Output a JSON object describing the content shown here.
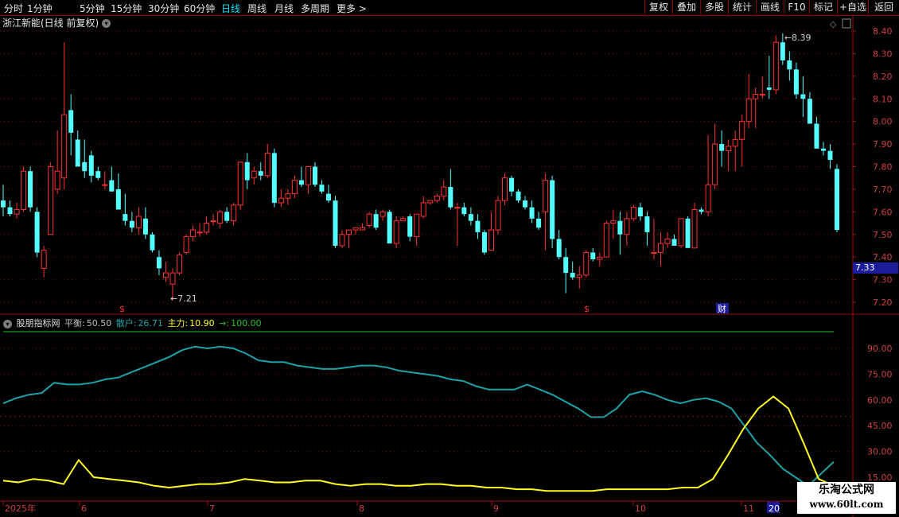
{
  "toolbar": {
    "periods": [
      "分时",
      "1分钟",
      "5分钟",
      "15分钟",
      "30分钟",
      "60分钟",
      "日线",
      "周线",
      "月线",
      "多周期",
      "更多 >"
    ],
    "active_period": "日线",
    "right_buttons": [
      "复权",
      "叠加",
      "多股",
      "统计",
      "画线",
      "F10",
      "标记",
      "+自选",
      "返回"
    ]
  },
  "title": {
    "name": "浙江新能(日线 前复权)"
  },
  "price_axis": [
    "8.40",
    "8.30",
    "8.20",
    "8.10",
    "8.00",
    "7.90",
    "7.80",
    "7.70",
    "7.60",
    "7.50",
    "7.40",
    "7.30",
    "7.20"
  ],
  "current_price": "7.33",
  "annotations": {
    "high": "8.39",
    "low": "7.21",
    "marker_s": "$",
    "marker_cai": "财"
  },
  "indicator": {
    "name": "股朋指标网",
    "balance_label": "平衡:",
    "balance_value": "50.50",
    "retail_label": "散户:",
    "retail_value": "26.71",
    "main_label": "主力:",
    "main_value": "10.90",
    "arrow_label": "→:",
    "arrow_value": "100.00",
    "axis": [
      "90.00",
      "75.00",
      "60.00",
      "45.00",
      "30.00",
      "15.00"
    ]
  },
  "date_axis": [
    "2025年",
    "6",
    "7",
    "8",
    "9",
    "10",
    "11",
    "20"
  ],
  "watermark": {
    "line1": "乐淘公式网",
    "line2": "www.60lt.com"
  },
  "colors": {
    "up": "#ff3232",
    "down": "#54ffff",
    "retail": "#1aa3a8",
    "main": "#ffff20",
    "balance": "#25c225"
  },
  "chart_data": {
    "type": "candlestick",
    "series": [
      {
        "name": "K线",
        "ohlc": [
          [
            7.65,
            7.72,
            7.58,
            7.62
          ],
          [
            7.62,
            7.65,
            7.58,
            7.59
          ],
          [
            7.59,
            7.64,
            7.57,
            7.61
          ],
          [
            7.61,
            7.8,
            7.6,
            7.78
          ],
          [
            7.78,
            7.8,
            7.6,
            7.62
          ],
          [
            7.6,
            7.62,
            7.4,
            7.42
          ],
          [
            7.35,
            7.45,
            7.31,
            7.43
          ],
          [
            7.5,
            7.82,
            7.5,
            7.8
          ],
          [
            7.7,
            7.96,
            7.68,
            7.78
          ],
          [
            7.75,
            8.35,
            7.7,
            8.03
          ],
          [
            8.05,
            8.12,
            7.85,
            7.95
          ],
          [
            7.92,
            7.96,
            7.8,
            7.8
          ],
          [
            7.82,
            7.92,
            7.75,
            7.78
          ],
          [
            7.85,
            7.87,
            7.73,
            7.76
          ],
          [
            7.78,
            7.8,
            7.74,
            7.75
          ],
          [
            7.72,
            7.78,
            7.7,
            7.72
          ],
          [
            7.74,
            7.8,
            7.69,
            7.69
          ],
          [
            7.7,
            7.77,
            7.61,
            7.61
          ],
          [
            7.59,
            7.68,
            7.54,
            7.56
          ],
          [
            7.56,
            7.6,
            7.51,
            7.53
          ],
          [
            7.53,
            7.62,
            7.5,
            7.58
          ],
          [
            7.57,
            7.62,
            7.48,
            7.5
          ],
          [
            7.5,
            7.51,
            7.42,
            7.43
          ],
          [
            7.4,
            7.43,
            7.32,
            7.35
          ],
          [
            7.31,
            7.38,
            7.29,
            7.33
          ],
          [
            7.28,
            7.35,
            7.21,
            7.33
          ],
          [
            7.33,
            7.42,
            7.32,
            7.41
          ],
          [
            7.42,
            7.5,
            7.41,
            7.49
          ],
          [
            7.49,
            7.54,
            7.47,
            7.52
          ],
          [
            7.51,
            7.55,
            7.49,
            7.51
          ],
          [
            7.51,
            7.58,
            7.5,
            7.55
          ],
          [
            7.56,
            7.59,
            7.54,
            7.56
          ],
          [
            7.55,
            7.61,
            7.53,
            7.6
          ],
          [
            7.6,
            7.62,
            7.55,
            7.56
          ],
          [
            7.56,
            7.64,
            7.54,
            7.63
          ],
          [
            7.63,
            7.82,
            7.61,
            7.82
          ],
          [
            7.82,
            7.86,
            7.7,
            7.74
          ],
          [
            7.75,
            7.8,
            7.72,
            7.78
          ],
          [
            7.78,
            7.82,
            7.74,
            7.76
          ],
          [
            7.76,
            7.9,
            7.75,
            7.86
          ],
          [
            7.86,
            7.88,
            7.62,
            7.64
          ],
          [
            7.64,
            7.7,
            7.62,
            7.66
          ],
          [
            7.66,
            7.7,
            7.63,
            7.68
          ],
          [
            7.68,
            7.76,
            7.66,
            7.74
          ],
          [
            7.74,
            7.8,
            7.71,
            7.72
          ],
          [
            7.72,
            7.8,
            7.68,
            7.8
          ],
          [
            7.8,
            7.82,
            7.71,
            7.72
          ],
          [
            7.72,
            7.74,
            7.68,
            7.69
          ],
          [
            7.68,
            7.72,
            7.64,
            7.65
          ],
          [
            7.65,
            7.67,
            7.44,
            7.45
          ],
          [
            7.45,
            7.52,
            7.44,
            7.5
          ],
          [
            7.5,
            7.52,
            7.44,
            7.52
          ],
          [
            7.52,
            7.53,
            7.5,
            7.53
          ],
          [
            7.52,
            7.55,
            7.52,
            7.53
          ],
          [
            7.54,
            7.6,
            7.53,
            7.59
          ],
          [
            7.59,
            7.61,
            7.52,
            7.53
          ],
          [
            7.58,
            7.61,
            7.56,
            7.6
          ],
          [
            7.6,
            7.61,
            7.46,
            7.46
          ],
          [
            7.46,
            7.58,
            7.44,
            7.56
          ],
          [
            7.56,
            7.58,
            7.57,
            7.57
          ],
          [
            7.58,
            7.59,
            7.47,
            7.49
          ],
          [
            7.49,
            7.59,
            7.45,
            7.59
          ],
          [
            7.58,
            7.67,
            7.57,
            7.64
          ],
          [
            7.64,
            7.65,
            7.63,
            7.65
          ],
          [
            7.65,
            7.68,
            7.64,
            7.67
          ],
          [
            7.67,
            7.74,
            7.65,
            7.71
          ],
          [
            7.71,
            7.79,
            7.61,
            7.62
          ],
          [
            7.62,
            7.64,
            7.45,
            7.62
          ],
          [
            7.62,
            7.64,
            7.58,
            7.59
          ],
          [
            7.59,
            7.62,
            7.54,
            7.56
          ],
          [
            7.56,
            7.59,
            7.48,
            7.51
          ],
          [
            7.51,
            7.52,
            7.41,
            7.42
          ],
          [
            7.43,
            7.6,
            7.43,
            7.52
          ],
          [
            7.52,
            7.67,
            7.5,
            7.65
          ],
          [
            7.65,
            7.77,
            7.63,
            7.75
          ],
          [
            7.75,
            7.76,
            7.67,
            7.69
          ],
          [
            7.69,
            7.7,
            7.64,
            7.65
          ],
          [
            7.65,
            7.67,
            7.61,
            7.62
          ],
          [
            7.62,
            7.65,
            7.55,
            7.57
          ],
          [
            7.57,
            7.6,
            7.52,
            7.53
          ],
          [
            7.6,
            7.77,
            7.43,
            7.74
          ],
          [
            7.74,
            7.76,
            7.44,
            7.48
          ],
          [
            7.48,
            7.52,
            7.39,
            7.4
          ],
          [
            7.4,
            7.44,
            7.24,
            7.33
          ],
          [
            7.33,
            7.38,
            7.3,
            7.31
          ],
          [
            7.31,
            7.36,
            7.26,
            7.32
          ],
          [
            7.32,
            7.43,
            7.31,
            7.42
          ],
          [
            7.42,
            7.44,
            7.38,
            7.39
          ],
          [
            7.39,
            7.42,
            7.36,
            7.4
          ],
          [
            7.4,
            7.56,
            7.4,
            7.55
          ],
          [
            7.55,
            7.61,
            7.48,
            7.56
          ],
          [
            7.56,
            7.6,
            7.41,
            7.5
          ],
          [
            7.5,
            7.6,
            7.45,
            7.57
          ],
          [
            7.57,
            7.63,
            7.56,
            7.62
          ],
          [
            7.62,
            7.64,
            7.56,
            7.58
          ],
          [
            7.58,
            7.6,
            7.45,
            7.51
          ],
          [
            7.42,
            7.57,
            7.39,
            7.42
          ],
          [
            7.42,
            7.51,
            7.36,
            7.46
          ],
          [
            7.46,
            7.51,
            7.44,
            7.48
          ],
          [
            7.48,
            7.5,
            7.45,
            7.45
          ],
          [
            7.45,
            7.57,
            7.44,
            7.57
          ],
          [
            7.57,
            7.58,
            7.44,
            7.44
          ],
          [
            7.44,
            7.64,
            7.44,
            7.61
          ],
          [
            7.61,
            7.62,
            7.59,
            7.6
          ],
          [
            7.6,
            7.94,
            7.58,
            7.72
          ],
          [
            7.72,
            7.99,
            7.7,
            7.9
          ],
          [
            7.9,
            7.96,
            7.8,
            7.87
          ],
          [
            7.87,
            7.92,
            7.78,
            7.89
          ],
          [
            7.89,
            7.96,
            7.78,
            7.92
          ],
          [
            7.92,
            8.03,
            7.8,
            8.0
          ],
          [
            8.0,
            8.21,
            7.97,
            8.1
          ],
          [
            8.1,
            8.15,
            7.97,
            8.12
          ],
          [
            8.12,
            8.2,
            8.1,
            8.12
          ],
          [
            8.15,
            8.29,
            8.1,
            8.14
          ],
          [
            8.14,
            8.38,
            8.12,
            8.35
          ],
          [
            8.35,
            8.39,
            8.25,
            8.27
          ],
          [
            8.27,
            8.31,
            8.18,
            8.23
          ],
          [
            8.23,
            8.26,
            8.1,
            8.12
          ],
          [
            8.12,
            8.2,
            8.02,
            8.1
          ],
          [
            8.1,
            8.13,
            8.0,
            7.99
          ],
          [
            7.99,
            8.02,
            7.88,
            7.88
          ],
          [
            7.88,
            7.91,
            7.85,
            7.87
          ],
          [
            7.87,
            7.9,
            7.79,
            7.83
          ],
          [
            7.79,
            7.81,
            7.51,
            7.52
          ]
        ]
      },
      {
        "name": "散户",
        "values": [
          58.0,
          61.0,
          63.0,
          64.0,
          70.0,
          69.0,
          69.0,
          70.0,
          72.0,
          73.0,
          76.0,
          79.0,
          82.0,
          85.0,
          89.0,
          91.0,
          90.0,
          91.0,
          90.0,
          87.0,
          83.0,
          82.0,
          82.0,
          80.0,
          79.0,
          78.0,
          78.0,
          79.0,
          80.0,
          80.0,
          79.0,
          77.0,
          76.0,
          75.0,
          74.0,
          72.0,
          71.0,
          68.0,
          66.0,
          66.0,
          66.0,
          69.0,
          66.0,
          63.0,
          59.0,
          55.0,
          50.0,
          50.0,
          55.0,
          63.0,
          65.0,
          63.0,
          60.0,
          58.0,
          60.0,
          61.0,
          59.0,
          55.0,
          45.0,
          35.0,
          28.0,
          20.0,
          15.0,
          10.0,
          17.0,
          24.0
        ]
      },
      {
        "name": "主力",
        "values": [
          13.0,
          12.0,
          14.0,
          13.0,
          11.0,
          25.0,
          15.0,
          14.0,
          13.0,
          12.0,
          10.0,
          9.0,
          10.0,
          11.0,
          11.0,
          12.0,
          14.0,
          13.0,
          12.0,
          12.0,
          13.0,
          13.0,
          11.0,
          10.0,
          11.0,
          11.0,
          10.0,
          10.0,
          11.0,
          11.0,
          10.0,
          10.0,
          9.0,
          9.0,
          8.0,
          8.0,
          7.0,
          7.0,
          7.0,
          7.0,
          8.0,
          8.0,
          8.0,
          8.0,
          8.0,
          9.0,
          9.0,
          14.0,
          28.0,
          43.0,
          55.0,
          62.0,
          55.0,
          35.0,
          14.0,
          10.0
        ]
      },
      {
        "name": "平衡",
        "values": [
          50.5
        ]
      },
      {
        "name": "→",
        "values": [
          100.0
        ]
      }
    ],
    "price_range": [
      7.2,
      8.4
    ],
    "indicator_range": [
      15,
      90
    ]
  }
}
